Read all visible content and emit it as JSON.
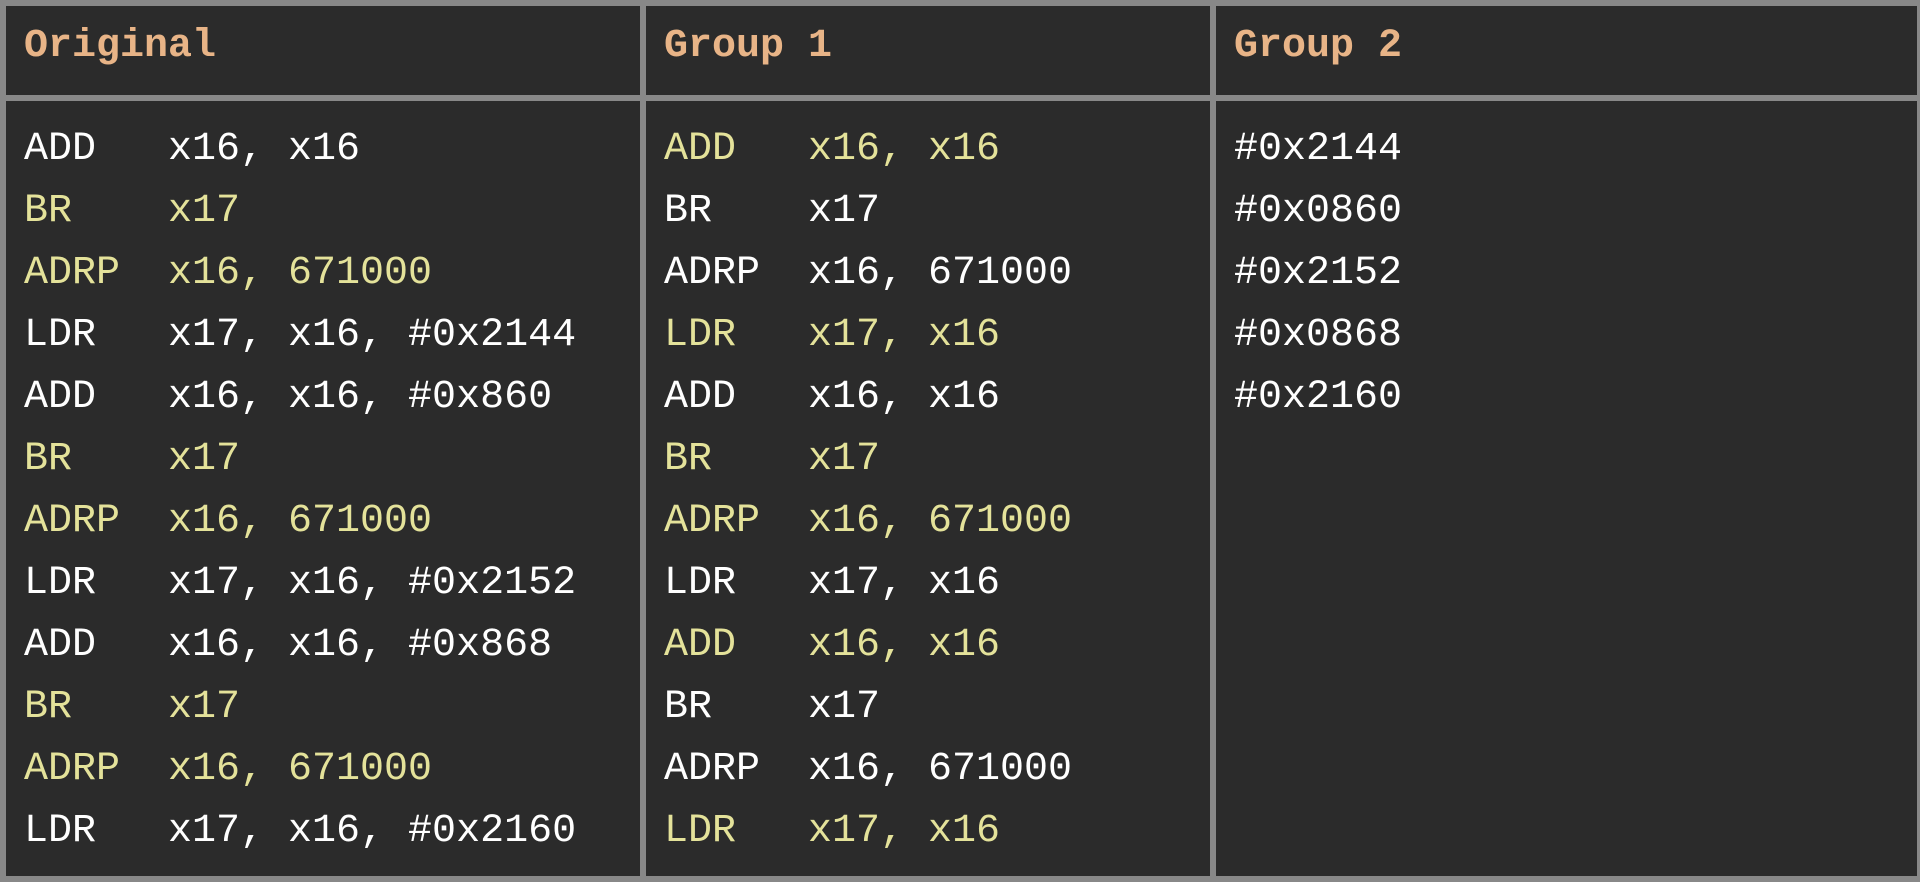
{
  "headers": {
    "col0": "Original",
    "col1": "Group 1",
    "col2": "Group 2"
  },
  "columns": {
    "original": [
      {
        "cls": "white",
        "op": "ADD",
        "args": "x16, x16"
      },
      {
        "cls": "olive",
        "op": "BR",
        "args": "x17"
      },
      {
        "cls": "olive",
        "op": "ADRP",
        "args": "x16, 671000"
      },
      {
        "cls": "white",
        "op": "LDR",
        "args": "x17, x16, #0x2144"
      },
      {
        "cls": "white",
        "op": "ADD",
        "args": "x16, x16, #0x860"
      },
      {
        "cls": "olive",
        "op": "BR",
        "args": "x17"
      },
      {
        "cls": "olive",
        "op": "ADRP",
        "args": "x16, 671000"
      },
      {
        "cls": "white",
        "op": "LDR",
        "args": "x17, x16, #0x2152"
      },
      {
        "cls": "white",
        "op": "ADD",
        "args": "x16, x16, #0x868"
      },
      {
        "cls": "olive",
        "op": "BR",
        "args": "x17"
      },
      {
        "cls": "olive",
        "op": "ADRP",
        "args": "x16, 671000"
      },
      {
        "cls": "white",
        "op": "LDR",
        "args": "x17, x16, #0x2160"
      }
    ],
    "group1": [
      {
        "cls": "olive",
        "op": "ADD",
        "args": "x16, x16"
      },
      {
        "cls": "white",
        "op": "BR",
        "args": "x17"
      },
      {
        "cls": "white",
        "op": "ADRP",
        "args": "x16, 671000"
      },
      {
        "cls": "olive",
        "op": "LDR",
        "args": "x17, x16"
      },
      {
        "cls": "white",
        "op": "ADD",
        "args": "x16, x16"
      },
      {
        "cls": "olive",
        "op": "BR",
        "args": "x17"
      },
      {
        "cls": "olive",
        "op": "ADRP",
        "args": "x16, 671000"
      },
      {
        "cls": "white",
        "op": "LDR",
        "args": "x17, x16"
      },
      {
        "cls": "olive",
        "op": "ADD",
        "args": "x16, x16"
      },
      {
        "cls": "white",
        "op": "BR",
        "args": "x17"
      },
      {
        "cls": "white",
        "op": "ADRP",
        "args": "x16, 671000"
      },
      {
        "cls": "olive",
        "op": "LDR",
        "args": "x17, x16"
      }
    ],
    "group2": [
      {
        "cls": "white",
        "text": "#0x2144"
      },
      {
        "cls": "white",
        "text": "#0x0860"
      },
      {
        "cls": "white",
        "text": "#0x2152"
      },
      {
        "cls": "white",
        "text": "#0x0868"
      },
      {
        "cls": "white",
        "text": "#0x2160"
      }
    ]
  }
}
